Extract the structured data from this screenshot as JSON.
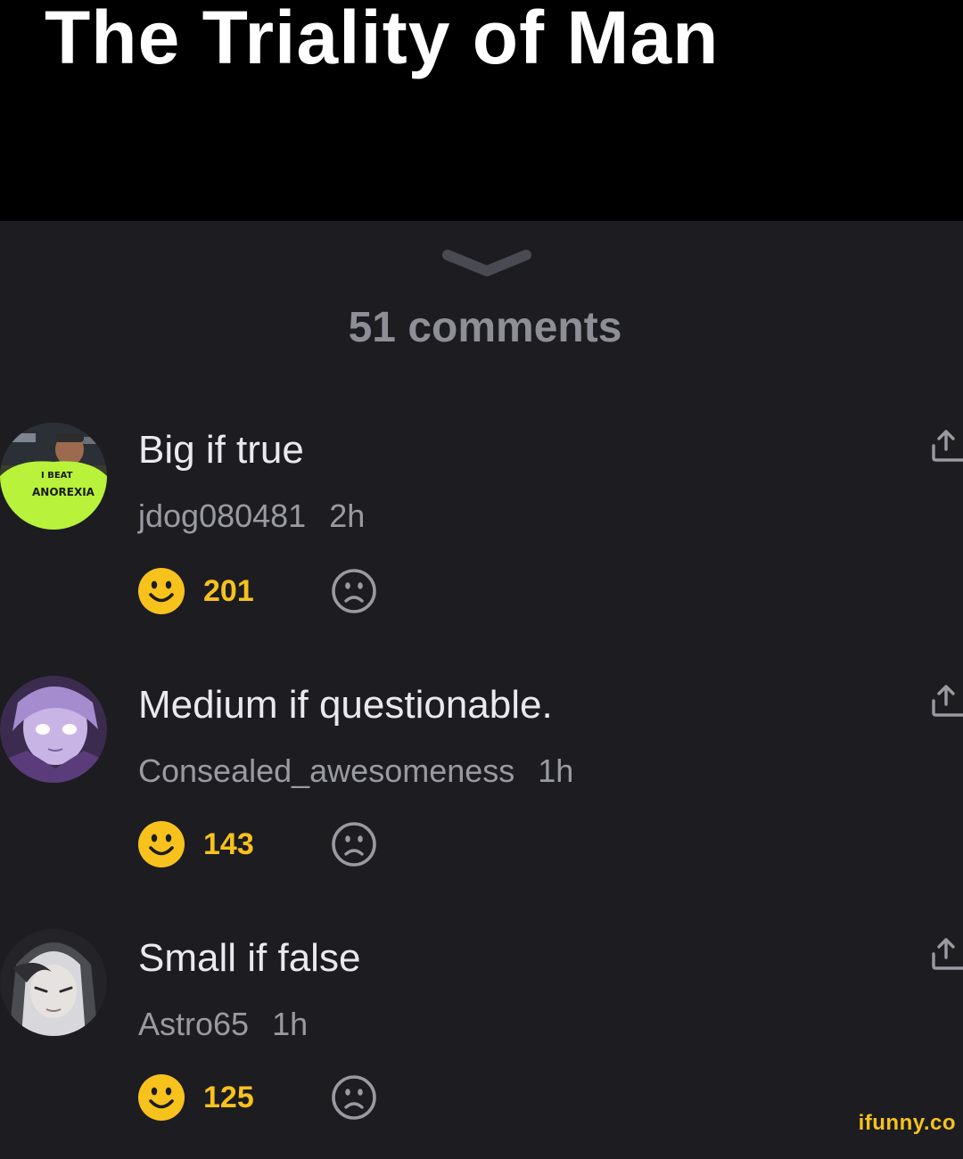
{
  "meme": {
    "title": "The Triality of Man"
  },
  "comments_panel": {
    "count_label": "51 comments",
    "items": [
      {
        "text": "Big if true",
        "username": "jdog080481",
        "time": "2h",
        "score": "201",
        "avatar_text": [
          "I BEAT",
          "ANOREXIA"
        ]
      },
      {
        "text": "Medium if questionable.",
        "username": "Consealed_awesomeness",
        "time": "1h",
        "score": "143"
      },
      {
        "text": "Small if false",
        "username": "Astro65",
        "time": "1h",
        "score": "125"
      }
    ]
  },
  "watermark": "ifunny.co",
  "icons": [
    "chevron-down-icon",
    "smile-icon",
    "frown-icon",
    "share-icon"
  ],
  "colors": {
    "banner_bg": "#000000",
    "panel_bg": "#1c1c21",
    "score": "#f7c21c",
    "text": "#e9e9ee",
    "meta": "#9a9aa2"
  }
}
